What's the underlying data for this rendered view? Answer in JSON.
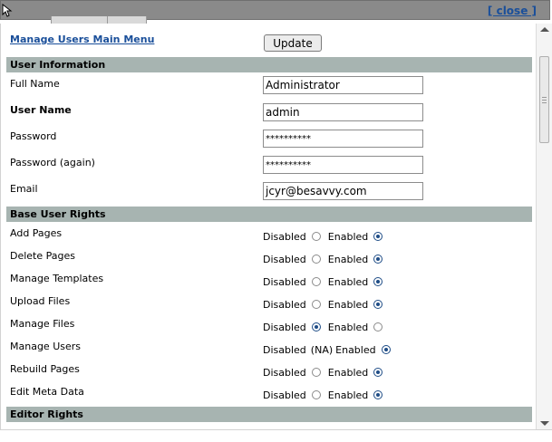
{
  "window": {
    "close_label": "[ close ]"
  },
  "nav": {
    "main_menu_label": "Manage Users Main Menu"
  },
  "toolbar": {
    "update_label": "Update"
  },
  "sections": {
    "user_info": "User Information",
    "base_rights": "Base User Rights",
    "editor_rights": "Editor Rights"
  },
  "fields": {
    "full_name": {
      "label": "Full Name",
      "value": "Administrator"
    },
    "user_name": {
      "label": "User Name",
      "value": "admin"
    },
    "password": {
      "label": "Password",
      "value": "**********"
    },
    "password_again": {
      "label": "Password (again)",
      "value": "**********"
    },
    "email": {
      "label": "Email",
      "value": "jcyr@besavvy.com"
    }
  },
  "rights_text": {
    "disabled": "Disabled",
    "enabled": "Enabled",
    "na": "(NA)"
  },
  "rights": [
    {
      "label": "Add Pages",
      "state": "enabled"
    },
    {
      "label": "Delete Pages",
      "state": "enabled"
    },
    {
      "label": "Manage Templates",
      "state": "enabled"
    },
    {
      "label": "Upload Files",
      "state": "enabled"
    },
    {
      "label": "Manage Files",
      "state": "disabled"
    },
    {
      "label": "Manage Users",
      "state": "enabled",
      "disabled_na": true
    },
    {
      "label": "Rebuild Pages",
      "state": "enabled"
    },
    {
      "label": "Edit Meta Data",
      "state": "enabled"
    }
  ]
}
